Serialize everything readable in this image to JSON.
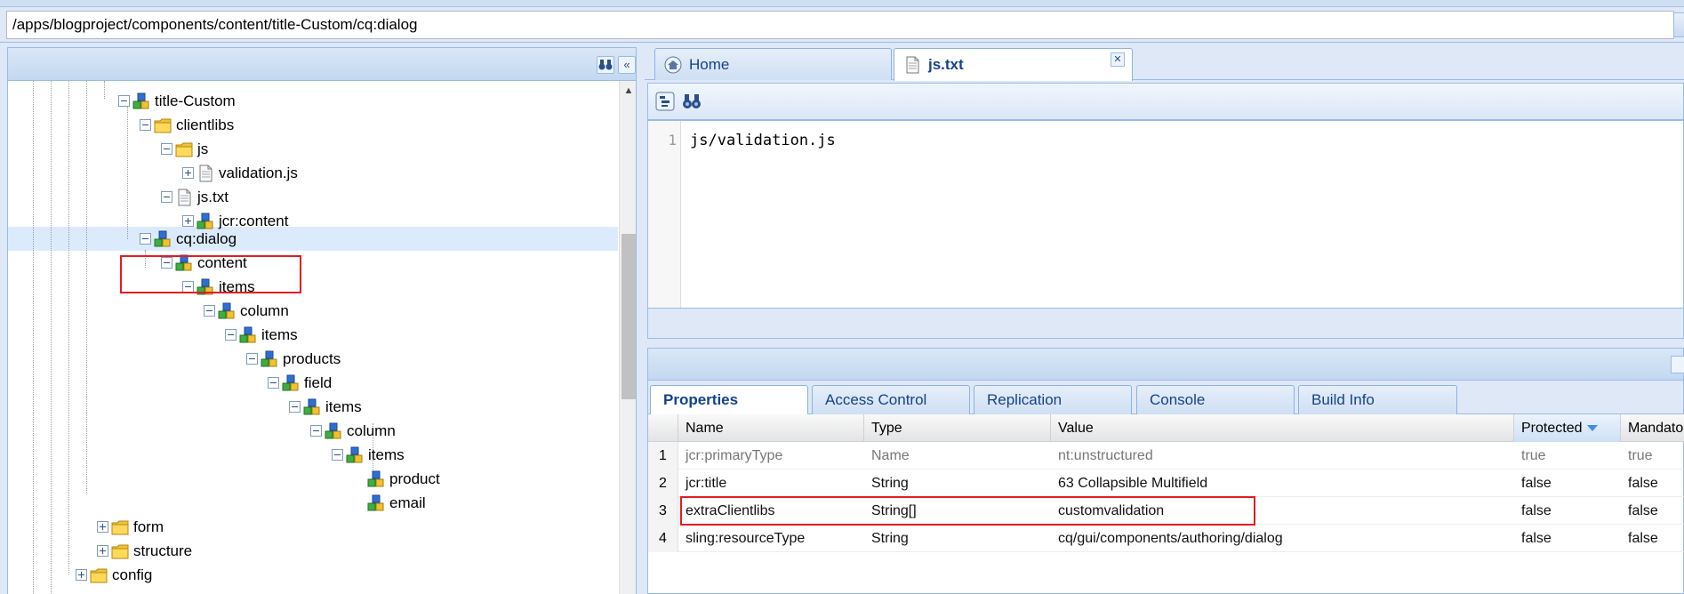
{
  "address_bar": {
    "path": "/apps/blogproject/components/content/title-Custom/cq:dialog"
  },
  "tree": {
    "nodes": [
      {
        "label": "title-Custom",
        "icon": "component-node-icon"
      },
      {
        "label": "clientlibs",
        "icon": "folder-icon"
      },
      {
        "label": "js",
        "icon": "folder-icon"
      },
      {
        "label": "validation.js",
        "icon": "file-icon"
      },
      {
        "label": "js.txt",
        "icon": "file-icon"
      },
      {
        "label": "jcr:content",
        "icon": "component-node-icon"
      },
      {
        "label": "cq:dialog",
        "icon": "component-node-icon"
      },
      {
        "label": "content",
        "icon": "component-node-icon"
      },
      {
        "label": "items",
        "icon": "component-node-icon"
      },
      {
        "label": "column",
        "icon": "component-node-icon"
      },
      {
        "label": "items",
        "icon": "component-node-icon"
      },
      {
        "label": "products",
        "icon": "component-node-icon"
      },
      {
        "label": "field",
        "icon": "component-node-icon"
      },
      {
        "label": "items",
        "icon": "component-node-icon"
      },
      {
        "label": "column",
        "icon": "component-node-icon"
      },
      {
        "label": "items",
        "icon": "component-node-icon"
      },
      {
        "label": "product",
        "icon": "component-node-icon"
      },
      {
        "label": "email",
        "icon": "component-node-icon"
      },
      {
        "label": "form",
        "icon": "folder-icon"
      },
      {
        "label": "structure",
        "icon": "folder-icon"
      },
      {
        "label": "config",
        "icon": "folder-icon"
      }
    ]
  },
  "editor_tabs": [
    {
      "label": "Home",
      "icon": "home-icon"
    },
    {
      "label": "js.txt",
      "icon": "file-icon"
    }
  ],
  "editor": {
    "lines": [
      {
        "number": "1",
        "text": "js/validation.js"
      }
    ]
  },
  "properties": {
    "tabs": [
      "Properties",
      "Access Control",
      "Replication",
      "Console",
      "Build Info"
    ],
    "columns": [
      "Name",
      "Type",
      "Value",
      "Protected",
      "Mandato"
    ],
    "rows": [
      {
        "n": "1",
        "name": "jcr:primaryType",
        "type": "Name",
        "value": "nt:unstructured",
        "protected": "true",
        "mandatory": "true"
      },
      {
        "n": "2",
        "name": "jcr:title",
        "type": "String",
        "value": "63 Collapsible Multifield",
        "protected": "false",
        "mandatory": "false"
      },
      {
        "n": "3",
        "name": "extraClientlibs",
        "type": "String[]",
        "value": "customvalidation",
        "protected": "false",
        "mandatory": "false"
      },
      {
        "n": "4",
        "name": "sling:resourceType",
        "type": "String",
        "value": "cq/gui/components/authoring/dialog",
        "protected": "false",
        "mandatory": "false"
      }
    ]
  },
  "colors": {
    "highlight": "#e31b23",
    "tab_text": "#15428b",
    "panel_bg": "#dfe8f6"
  }
}
